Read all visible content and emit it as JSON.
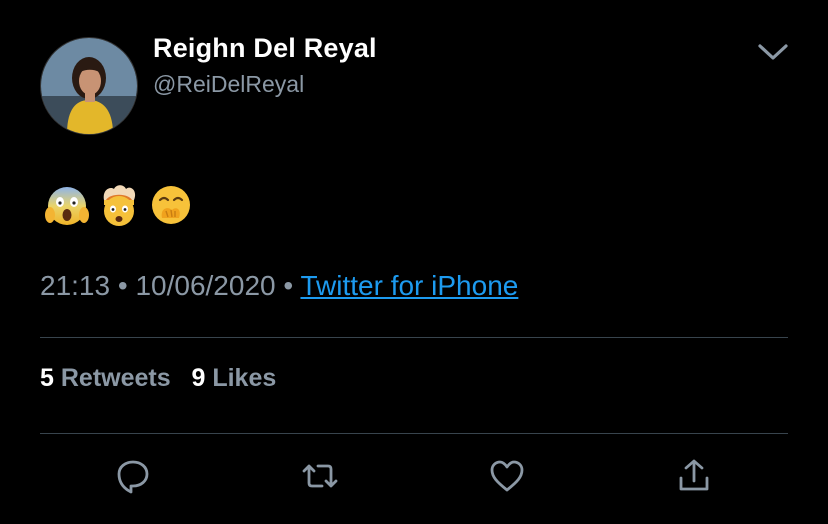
{
  "author": {
    "display_name": "Reighn Del Reyal",
    "handle": "@ReiDelReyal"
  },
  "tweet": {
    "emojis": [
      "face-screaming-in-fear",
      "exploding-head",
      "face-with-hand-over-mouth"
    ],
    "time": "21:13",
    "date": "10/06/2020",
    "separator": "•",
    "source": "Twitter for iPhone"
  },
  "stats": {
    "retweets_count": "5",
    "retweets_label": "Retweets",
    "likes_count": "9",
    "likes_label": "Likes"
  },
  "colors": {
    "background": "#000000",
    "secondary_text": "#8b98a5",
    "link": "#1d9bf0",
    "divider": "#38444d"
  },
  "actions": [
    "reply-icon",
    "retweet-icon",
    "like-icon",
    "share-icon"
  ]
}
